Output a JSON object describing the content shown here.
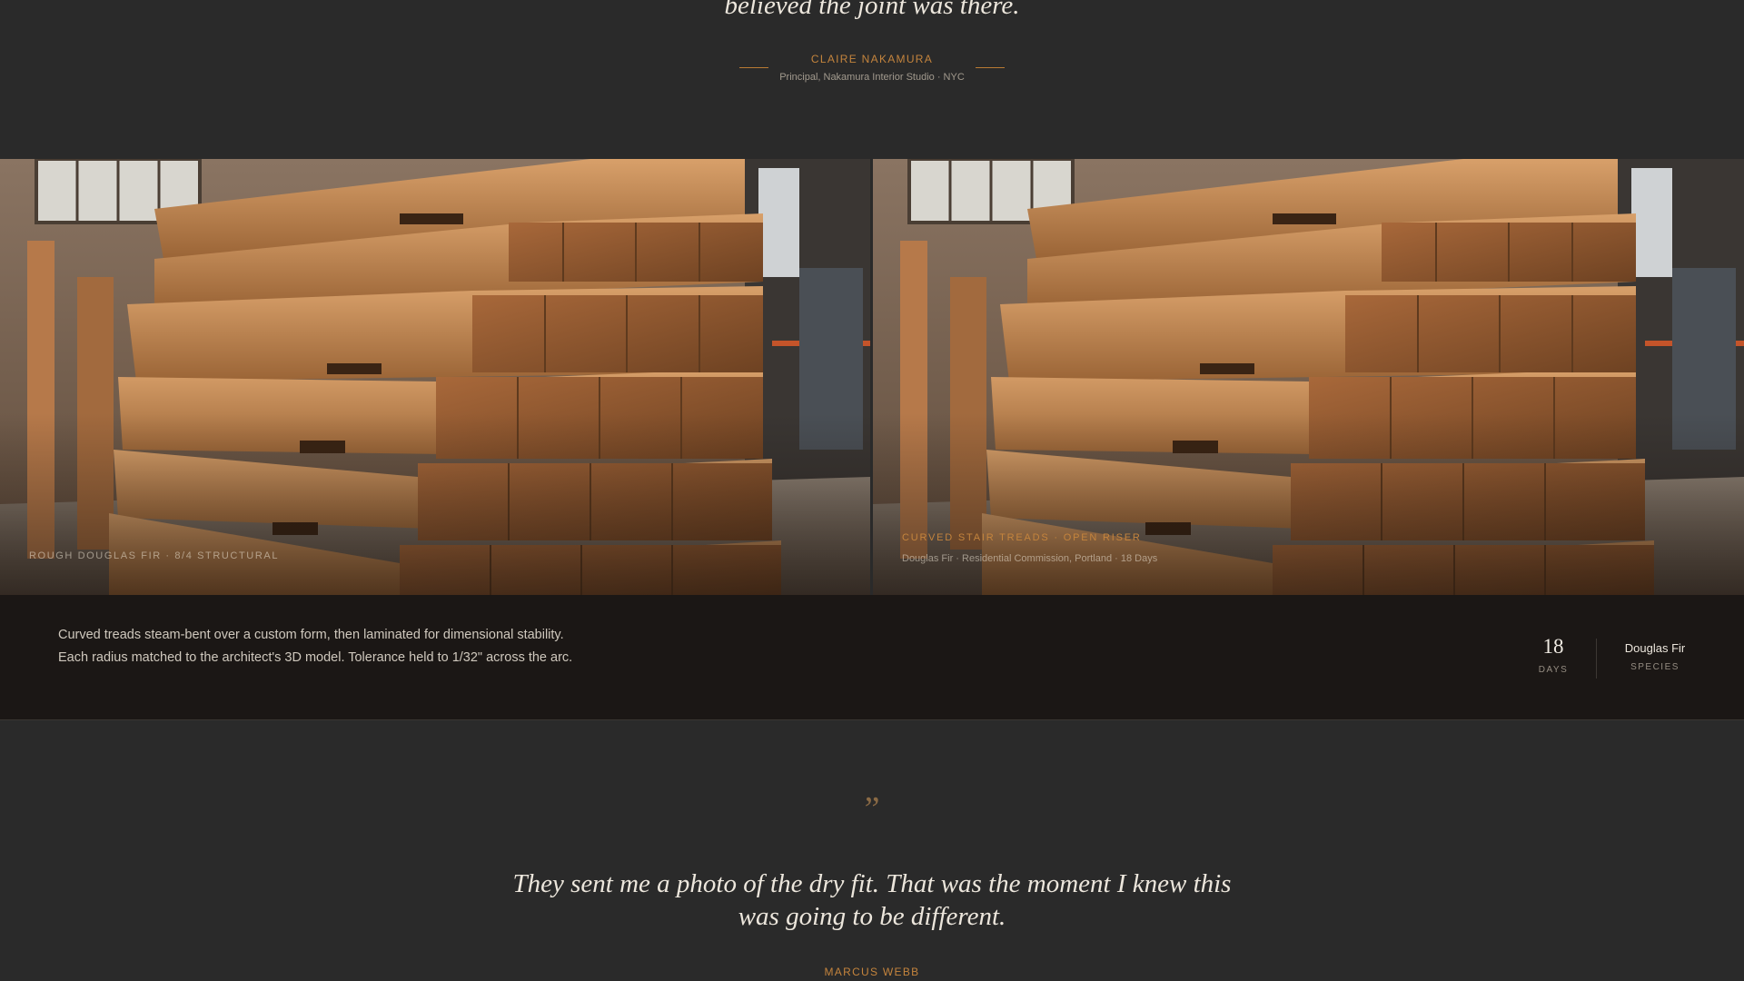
{
  "testimonial_top": {
    "quote_tail": "believed the joint was there.",
    "name": "CLAIRE NAKAMURA",
    "role": "Principal, Nakamura Interior Studio · NYC"
  },
  "gallery": {
    "left_caption": "ROUGH DOUGLAS FIR · 8/4 STRUCTURAL",
    "right_title": "CURVED STAIR TREADS · OPEN RISER",
    "right_subtitle": "Douglas Fir · Residential Commission, Portland · 18 Days"
  },
  "project": {
    "description": "Curved treads steam-bent over a custom form, then laminated for dimensional stability. Each radius matched to the architect's 3D model. Tolerance held to 1/32\" across the arc.",
    "days_value": "18",
    "days_label": "DAYS",
    "species_value": "Douglas Fir",
    "species_label": "SPECIES"
  },
  "testimonial_bottom": {
    "quote_mark": "”",
    "quote": "They sent me a photo of the dry fit. That was the moment I knew this was going to be different.",
    "name": "MARCUS WEBB"
  },
  "colors": {
    "background": "#2a2a2a",
    "band": "#1b1715",
    "accent": "#c4843d"
  },
  "icons": [
    "quote-mark-icon"
  ]
}
